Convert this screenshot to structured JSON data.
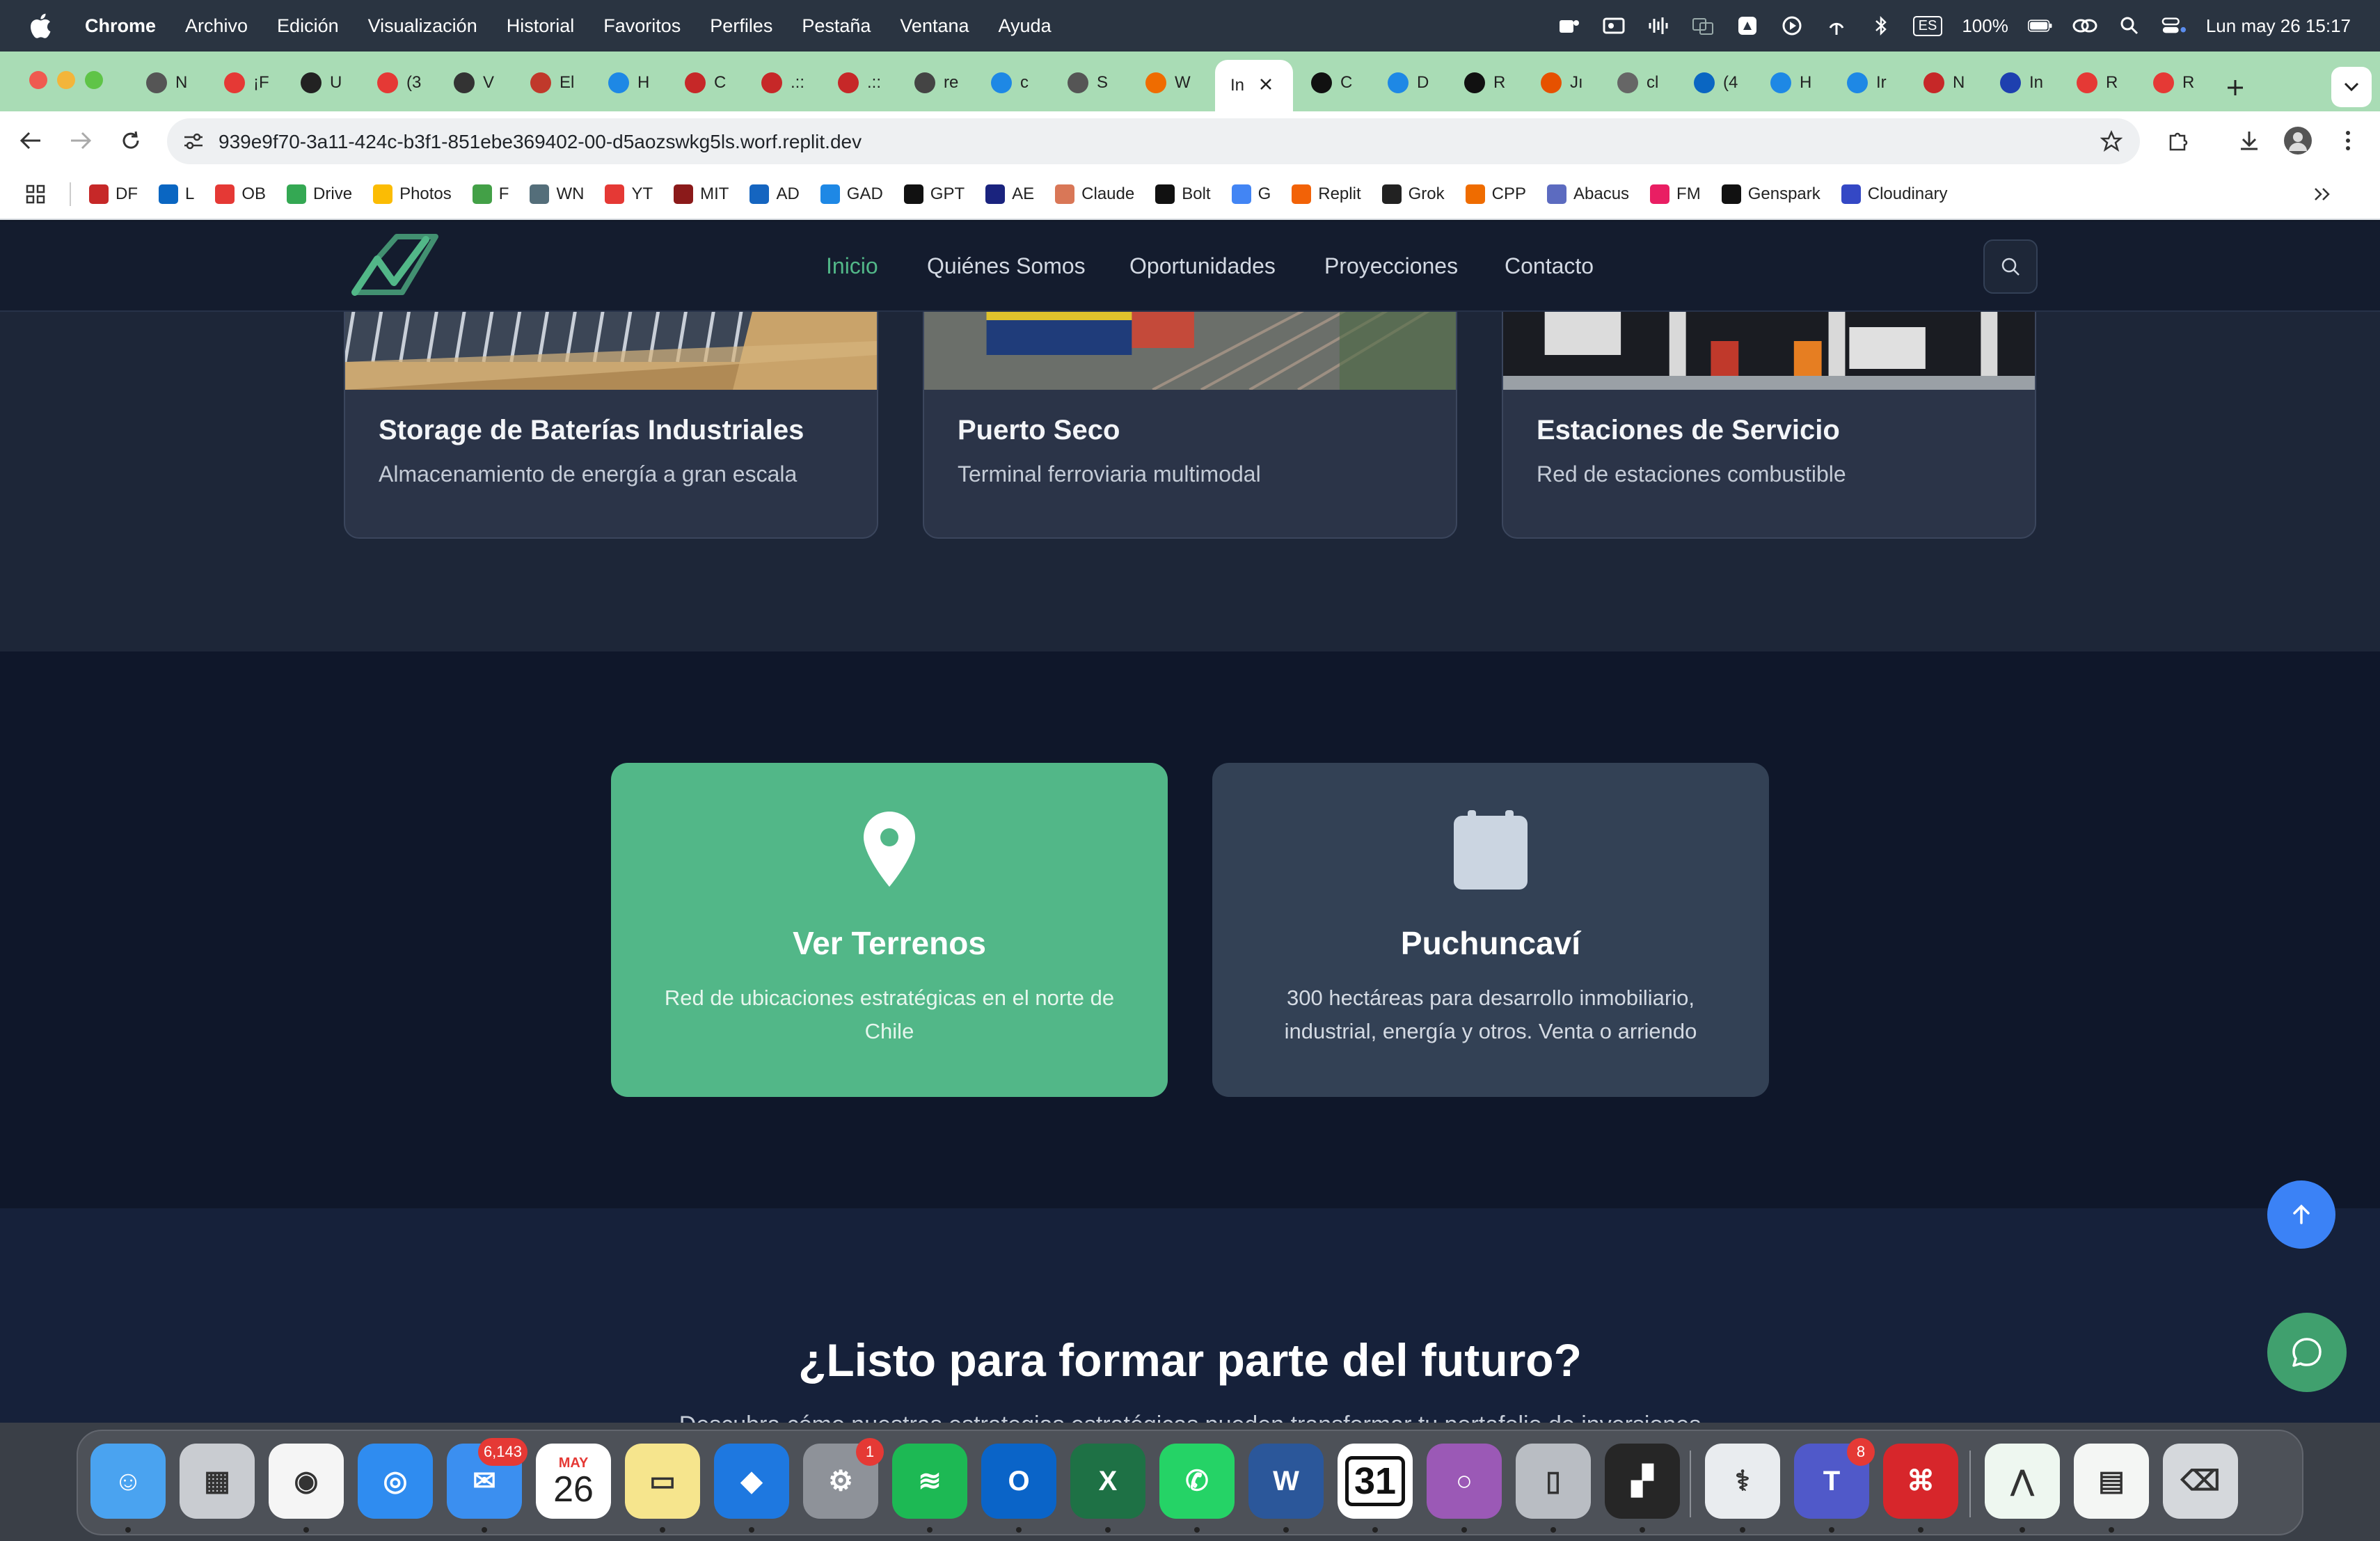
{
  "menubar": {
    "app_name": "Chrome",
    "items": [
      "Archivo",
      "Edición",
      "Visualización",
      "Historial",
      "Favoritos",
      "Perfiles",
      "Pestaña",
      "Ventana",
      "Ayuda"
    ],
    "input_source": "ES",
    "battery": "100%",
    "datetime": "Lun may 26  15:17"
  },
  "tabs": [
    {
      "label": "N",
      "color": "#555"
    },
    {
      "label": "¡F",
      "color": "#e53935"
    },
    {
      "label": "U",
      "color": "#222"
    },
    {
      "label": "(3",
      "color": "#e53935"
    },
    {
      "label": "V",
      "color": "#333"
    },
    {
      "label": "El",
      "color": "#c0392b"
    },
    {
      "label": "H",
      "color": "#1e88e5"
    },
    {
      "label": "C",
      "color": "#c62828"
    },
    {
      "label": ".::",
      "color": "#c62828"
    },
    {
      "label": ".::",
      "color": "#c62828"
    },
    {
      "label": "re",
      "color": "#444"
    },
    {
      "label": "c",
      "color": "#1e88e5"
    },
    {
      "label": "S",
      "color": "#555"
    },
    {
      "label": "W",
      "color": "#ef6c00"
    },
    {
      "label": "In",
      "color": "#fff",
      "active": true
    },
    {
      "label": "C",
      "color": "#111"
    },
    {
      "label": "D",
      "color": "#1e88e5"
    },
    {
      "label": "R",
      "color": "#111"
    },
    {
      "label": "Jı",
      "color": "#e65100"
    },
    {
      "label": "cl",
      "color": "#666"
    },
    {
      "label": "(4",
      "color": "#0a66c2"
    },
    {
      "label": "H",
      "color": "#1e88e5"
    },
    {
      "label": "Ir",
      "color": "#1e88e5"
    },
    {
      "label": "N",
      "color": "#c62828"
    },
    {
      "label": "In",
      "color": "#1e40af"
    },
    {
      "label": "R",
      "color": "#e53935"
    },
    {
      "label": "R",
      "color": "#e53935"
    }
  ],
  "address_bar": {
    "url": "939e9f70-3a11-424c-b3f1-851ebe369402-00-d5aozswkg5ls.worf.replit.dev"
  },
  "bookmarks": [
    {
      "label": "DF",
      "color": "#c62828"
    },
    {
      "label": "L",
      "color": "#0a66c2"
    },
    {
      "label": "OB",
      "color": "#e53935"
    },
    {
      "label": "Drive",
      "color": "#34a853"
    },
    {
      "label": "Photos",
      "color": "#fbbc04"
    },
    {
      "label": "F",
      "color": "#43a047"
    },
    {
      "label": "WN",
      "color": "#546e7a"
    },
    {
      "label": "YT",
      "color": "#e53935"
    },
    {
      "label": "MIT",
      "color": "#8b1a1a"
    },
    {
      "label": "AD",
      "color": "#1565c0"
    },
    {
      "label": "GAD",
      "color": "#1e88e5"
    },
    {
      "label": "GPT",
      "color": "#111"
    },
    {
      "label": "AE",
      "color": "#1a237e"
    },
    {
      "label": "Claude",
      "color": "#d97757"
    },
    {
      "label": "Bolt",
      "color": "#111"
    },
    {
      "label": "G",
      "color": "#4285f4"
    },
    {
      "label": "Replit",
      "color": "#f26207"
    },
    {
      "label": "Grok",
      "color": "#222"
    },
    {
      "label": "CPP",
      "color": "#ef6c00"
    },
    {
      "label": "Abacus",
      "color": "#5c6bc0"
    },
    {
      "label": "FM",
      "color": "#e91e63"
    },
    {
      "label": "Genspark",
      "color": "#111"
    },
    {
      "label": "Cloudinary",
      "color": "#3448c5"
    }
  ],
  "site": {
    "nav": {
      "items": [
        "Inicio",
        "Quiénes Somos",
        "Oportunidades",
        "Proyecciones",
        "Contacto"
      ],
      "active": "Inicio"
    },
    "project_cards": [
      {
        "title": "Storage de Baterías Industriales",
        "subtitle": "Almacenamiento de energía a gran escala"
      },
      {
        "title": "Puerto Seco",
        "subtitle": "Terminal ferroviaria multimodal"
      },
      {
        "title": "Estaciones de Servicio",
        "subtitle": "Red de estaciones combustible"
      }
    ],
    "features": [
      {
        "title": "Ver Terrenos",
        "description": "Red de ubicaciones estratégicas en el norte de Chile",
        "icon": "map-pin-icon",
        "background": "#52b788"
      },
      {
        "title": "Puchuncaví",
        "description": "300 hectáreas para desarrollo inmobiliario, industrial, energía y otros. Venta o arriendo",
        "icon": "calendar-icon",
        "background": "#334155"
      }
    ],
    "cta": {
      "title": "¿Listo para formar parte del futuro?",
      "description": "Descubra cómo nuestras estrategias estratégicas pueden transformar tu portafolio de inversiones"
    },
    "colors": {
      "accent": "#52b788",
      "header_bg": "#141c2e",
      "scroll_button": "#3b82f6",
      "chat_button": "#40a06e"
    }
  },
  "dock": {
    "apps": [
      {
        "name": "Finder",
        "badge": ""
      },
      {
        "name": "Launchpad",
        "badge": ""
      },
      {
        "name": "Chrome",
        "badge": ""
      },
      {
        "name": "Safari",
        "badge": ""
      },
      {
        "name": "Mail",
        "badge": "6,143"
      },
      {
        "name": "Calendar",
        "badge": "",
        "month": "MAY",
        "day": "26"
      },
      {
        "name": "Notes",
        "badge": ""
      },
      {
        "name": "Keynote",
        "badge": ""
      },
      {
        "name": "System Settings",
        "badge": "1"
      },
      {
        "name": "Spotify",
        "badge": ""
      },
      {
        "name": "Outlook",
        "badge": ""
      },
      {
        "name": "Excel",
        "badge": ""
      },
      {
        "name": "WhatsApp",
        "badge": ""
      },
      {
        "name": "Word",
        "badge": ""
      },
      {
        "name": "Calendar 31",
        "badge": "",
        "day": "31"
      },
      {
        "name": "Circle",
        "badge": ""
      },
      {
        "name": "iPhone Mirroring",
        "badge": ""
      },
      {
        "name": "Replit",
        "badge": ""
      },
      {
        "name": "Preview",
        "badge": ""
      },
      {
        "name": "Teams",
        "badge": "8"
      },
      {
        "name": "Acrobat",
        "badge": ""
      },
      {
        "name": "Site Window",
        "badge": ""
      },
      {
        "name": "Excel Window",
        "badge": ""
      },
      {
        "name": "Trash",
        "badge": ""
      }
    ]
  }
}
